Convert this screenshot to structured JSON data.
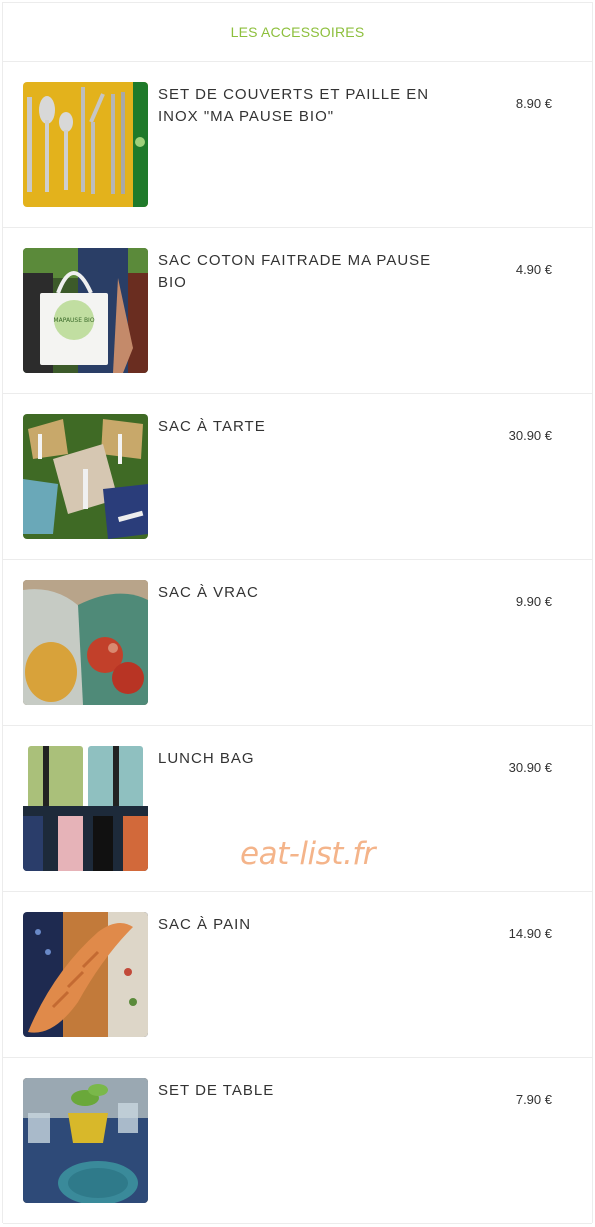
{
  "section": {
    "title": "LES ACCESSOIRES",
    "accent_color": "#8dbf3c"
  },
  "items": [
    {
      "name": "SET DE COUVERTS ET PAILLE EN INOX \"MA PAUSE BIO\"",
      "price": "8.90 €",
      "image": "cutlery-set-photo"
    },
    {
      "name": "SAC COTON FAITRADE MA PAUSE BIO",
      "price": "4.90 €",
      "image": "tote-bag-photo"
    },
    {
      "name": "SAC À TARTE",
      "price": "30.90 €",
      "image": "pie-bag-photo"
    },
    {
      "name": "SAC À VRAC",
      "price": "9.90 €",
      "image": "bulk-bag-photo"
    },
    {
      "name": "LUNCH BAG",
      "price": "30.90 €",
      "image": "lunch-bag-photo"
    },
    {
      "name": "SAC À PAIN",
      "price": "14.90 €",
      "image": "bread-bag-photo"
    },
    {
      "name": "SET DE TABLE",
      "price": "7.90 €",
      "image": "placemat-photo"
    }
  ],
  "watermark": "eat-list.fr"
}
